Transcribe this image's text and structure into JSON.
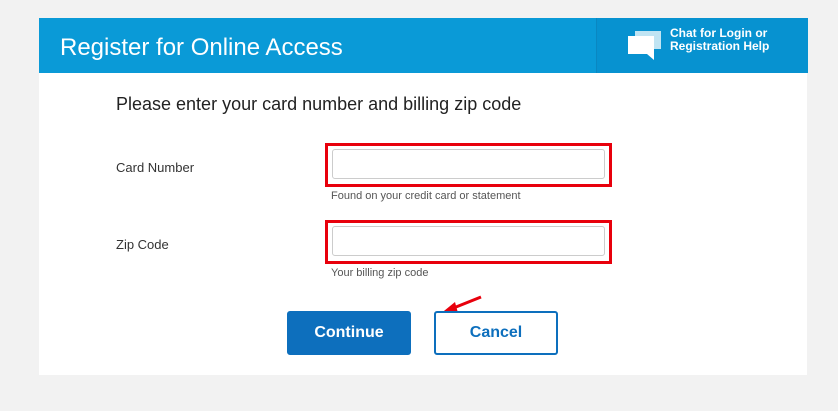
{
  "header": {
    "title": "Register for Online Access",
    "chat": {
      "line1": "Chat for Login or",
      "line2": "Registration Help",
      "icon": "chat-bubbles-icon"
    }
  },
  "form": {
    "instruction": "Please enter your card number and billing zip code",
    "card_number": {
      "label": "Card Number",
      "value": "",
      "hint": "Found on your credit card or statement"
    },
    "zip_code": {
      "label": "Zip Code",
      "value": "",
      "hint": "Your billing zip code"
    }
  },
  "buttons": {
    "continue": "Continue",
    "cancel": "Cancel"
  },
  "colors": {
    "header_bg": "#0a9ad7",
    "primary": "#0d6fbd",
    "highlight": "#e8000c",
    "page_bg": "#f2f2f2"
  }
}
